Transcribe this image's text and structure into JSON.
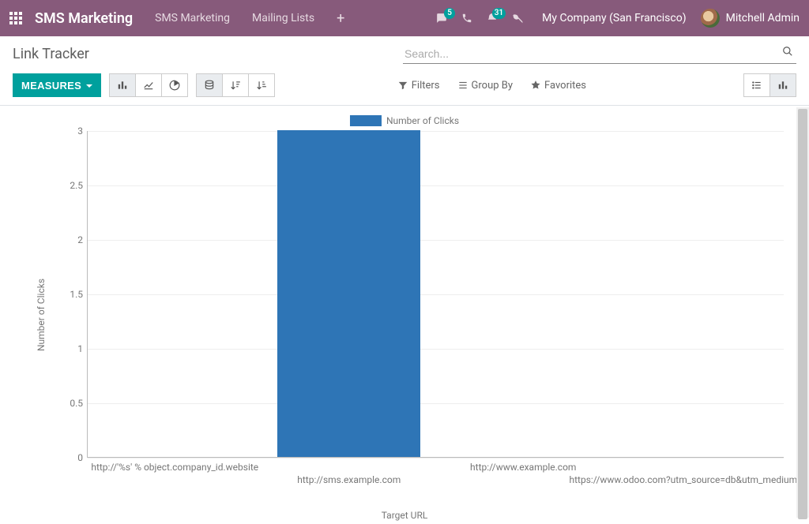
{
  "topnav": {
    "brand": "SMS Marketing",
    "menu": [
      "SMS Marketing",
      "Mailing Lists"
    ],
    "badges": {
      "discuss": "5",
      "activities": "31"
    },
    "company": "My Company (San Francisco)",
    "user": "Mitchell Admin"
  },
  "breadcrumb": "Link Tracker",
  "search": {
    "placeholder": "Search..."
  },
  "cp": {
    "measures": "Measures",
    "filters": "Filters",
    "groupby": "Group By",
    "favorites": "Favorites"
  },
  "chart_data": {
    "type": "bar",
    "title": "",
    "xlabel": "Target URL",
    "ylabel": "Number of Clicks",
    "legend": "Number of Clicks",
    "categories": [
      "http://'%s' % object.company_id.website",
      "http://sms.example.com",
      "http://www.example.com",
      "https://www.odoo.com?utm_source=db&utm_medium=email"
    ],
    "values": [
      0,
      3,
      0,
      0
    ],
    "yticks": [
      0,
      0.5,
      1,
      1.5,
      2,
      2.5,
      3
    ],
    "ylim": [
      0,
      3
    ]
  }
}
